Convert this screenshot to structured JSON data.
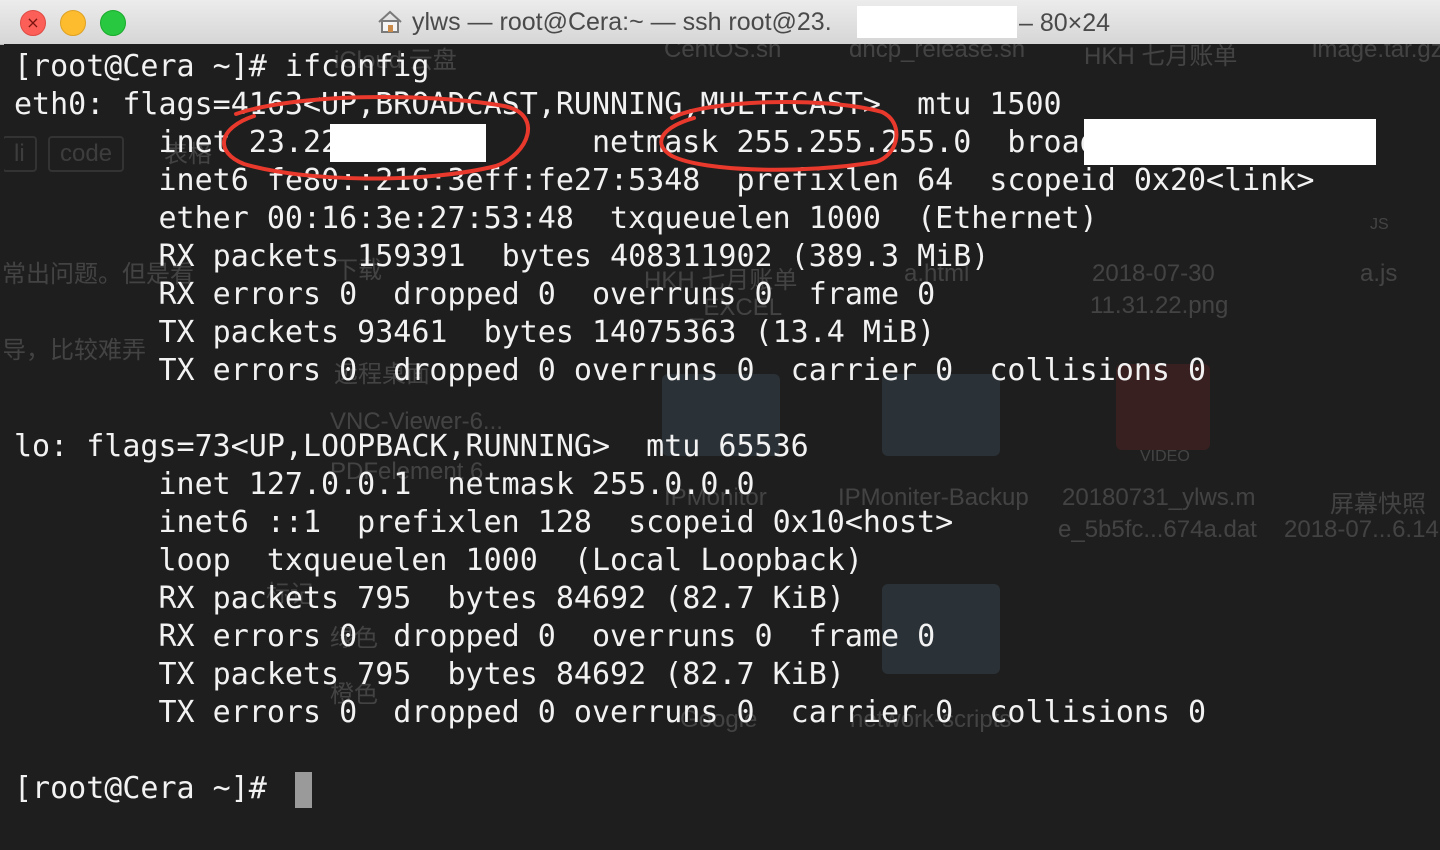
{
  "window": {
    "title_prefix": "ylws — root@Cera:~ — ssh root@23.",
    "title_suffix": "– 80×24",
    "close_glyph": "×"
  },
  "background_finder": {
    "items": [
      "iCloud 云盘",
      "CentOS.sh",
      "dhcp_release.sh",
      "HKH 七月账单",
      "image.tar.gz",
      "li",
      "code",
      "表格",
      "JS",
      "常出问题。但是看",
      "下载",
      "HKH 七月账单",
      "a.html",
      "2018-07-30",
      "11.31.22.png",
      "a.js",
      "_EXCEL",
      "导，比较难弄",
      "远程桌面",
      "VNC-Viewer-6...",
      "PDFelement 6",
      "IPMonitor",
      "IPMoniter-Backup",
      "20180731_ylws.m",
      "e_5b5fc...674a.dat",
      "屏幕快照",
      "2018-07...6.14",
      "VIDEO",
      "标记",
      "绿色",
      "橙色",
      "Google",
      "network-scripts"
    ]
  },
  "terminal": {
    "lines": [
      "[root@Cera ~]# ifconfig",
      "eth0: flags=4163<UP,BROADCAST,RUNNING,MULTICAST>  mtu 1500",
      "        inet 23.22              netmask 255.255.255.0  broadcast",
      "        inet6 fe80::216:3eff:fe27:5348  prefixlen 64  scopeid 0x20<link>",
      "        ether 00:16:3e:27:53:48  txqueuelen 1000  (Ethernet)",
      "        RX packets 159391  bytes 408311902 (389.3 MiB)",
      "        RX errors 0  dropped 0  overruns 0  frame 0",
      "        TX packets 93461  bytes 14075363 (13.4 MiB)",
      "        TX errors 0  dropped 0 overruns 0  carrier 0  collisions 0",
      "",
      "lo: flags=73<UP,LOOPBACK,RUNNING>  mtu 65536",
      "        inet 127.0.0.1  netmask 255.0.0.0",
      "        inet6 ::1  prefixlen 128  scopeid 0x10<host>",
      "        loop  txqueuelen 1000  (Local Loopback)",
      "        RX packets 795  bytes 84692 (82.7 KiB)",
      "        RX errors 0  dropped 0  overruns 0  frame 0",
      "        TX packets 795  bytes 84692 (82.7 KiB)",
      "        TX errors 0  dropped 0 overruns 0  carrier 0  collisions 0",
      "",
      "[root@Cera ~]# "
    ]
  },
  "annotation_color": "#e8392c"
}
